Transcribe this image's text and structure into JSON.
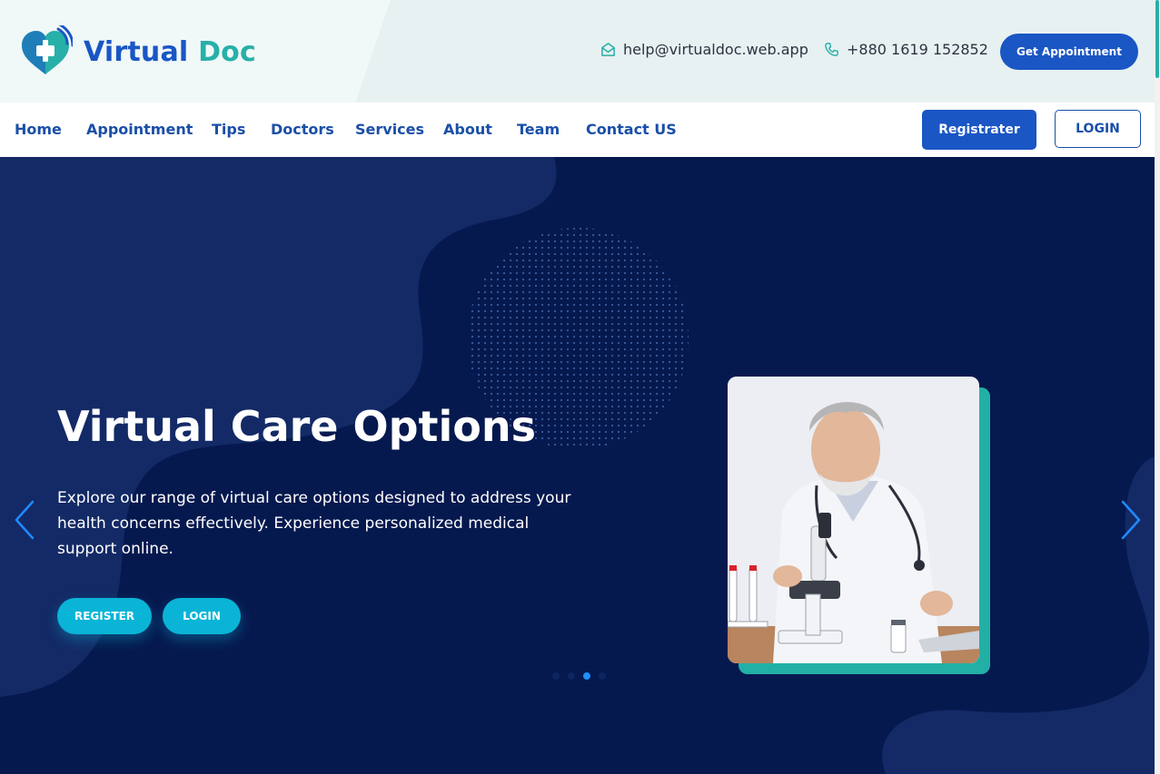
{
  "brand": {
    "name_part1": "Virtual",
    "name_part2": "Doc"
  },
  "contact": {
    "email": "help@virtualdoc.web.app",
    "phone": "+880 1619 152852"
  },
  "header": {
    "appointment_button": "Get Appointment"
  },
  "nav": {
    "items": [
      {
        "label": "Home"
      },
      {
        "label": "Appointment"
      },
      {
        "label": "Tips"
      },
      {
        "label": "Doctors"
      },
      {
        "label": "Services"
      },
      {
        "label": "About"
      },
      {
        "label": "Team"
      },
      {
        "label": "Contact US"
      }
    ],
    "register_label": "Registrater",
    "login_label": "LOGIN"
  },
  "hero": {
    "title": "Virtual Care Options",
    "description": "Explore our range of virtual care options designed to address your health concerns effectively. Experience personalized medical support online.",
    "register_label": "REGISTER",
    "login_label": "LOGIN",
    "slides_total": 4,
    "active_slide": 3
  },
  "colors": {
    "primary": "#1a56c4",
    "teal": "#27b0a8",
    "hero_bg": "#06194f",
    "cyan_button": "#0ab4d6"
  }
}
